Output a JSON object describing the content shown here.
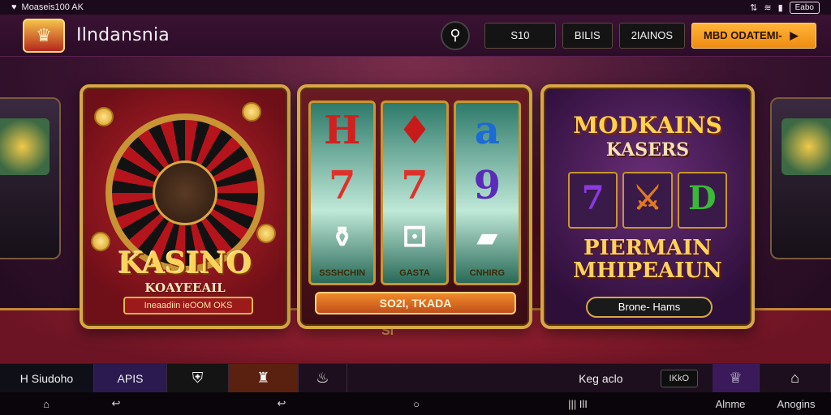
{
  "status_bar": {
    "left_text": "Moaseis100 AK",
    "battery": "Eabo"
  },
  "header": {
    "title": "Ilndansnia",
    "buttons": [
      "S10",
      "BILIS",
      "2IAINOS"
    ],
    "cta": "MBD ODATEMI-"
  },
  "panels": {
    "roulette": {
      "title": "KASINO",
      "subtitle": "KOAYEEAIL",
      "tagline": "Ineaadiin ieOOM OKS"
    },
    "slots": {
      "reels": [
        {
          "top": "H",
          "middle": "7",
          "label": "SSSHCHIN",
          "top_color": "#d22020",
          "mid_color": "#e0302a"
        },
        {
          "top": "♦",
          "middle": "7",
          "label": "GASTA",
          "top_color": "#c91a1a",
          "mid_color": "#e0302a"
        },
        {
          "top": "a",
          "middle": "9",
          "label": "CNHIRG",
          "top_color": "#1a6ad8",
          "mid_color": "#5a2ab8"
        }
      ],
      "cta": "SO2I, TKADA"
    },
    "promo": {
      "title": "MODKAINS",
      "subtitle": "KASERS",
      "reels": [
        {
          "glyph": "7",
          "color": "#8a3ae0"
        },
        {
          "glyph": "⚔",
          "color": "#e07a20"
        },
        {
          "glyph": "D",
          "color": "#3ab83a"
        }
      ],
      "headline_line1": "PIERMAIN",
      "headline_line2": "MHIPEAIUN",
      "button": "Brone- Hams"
    },
    "table_mark": "SI"
  },
  "tabbar": {
    "tabs": [
      "H Siudoho",
      "APIS"
    ],
    "right_label": "Keg aclo",
    "chip": "IKkO",
    "right_tabs": [
      "Alnme",
      "Anogins"
    ]
  },
  "navbar": {
    "items": [
      "⌂",
      "↩",
      "↩",
      "○",
      "|||  IlI"
    ]
  },
  "colors": {
    "accent": "#f5a623",
    "gold": "#d9a744",
    "felt": "#8c1a2a"
  }
}
